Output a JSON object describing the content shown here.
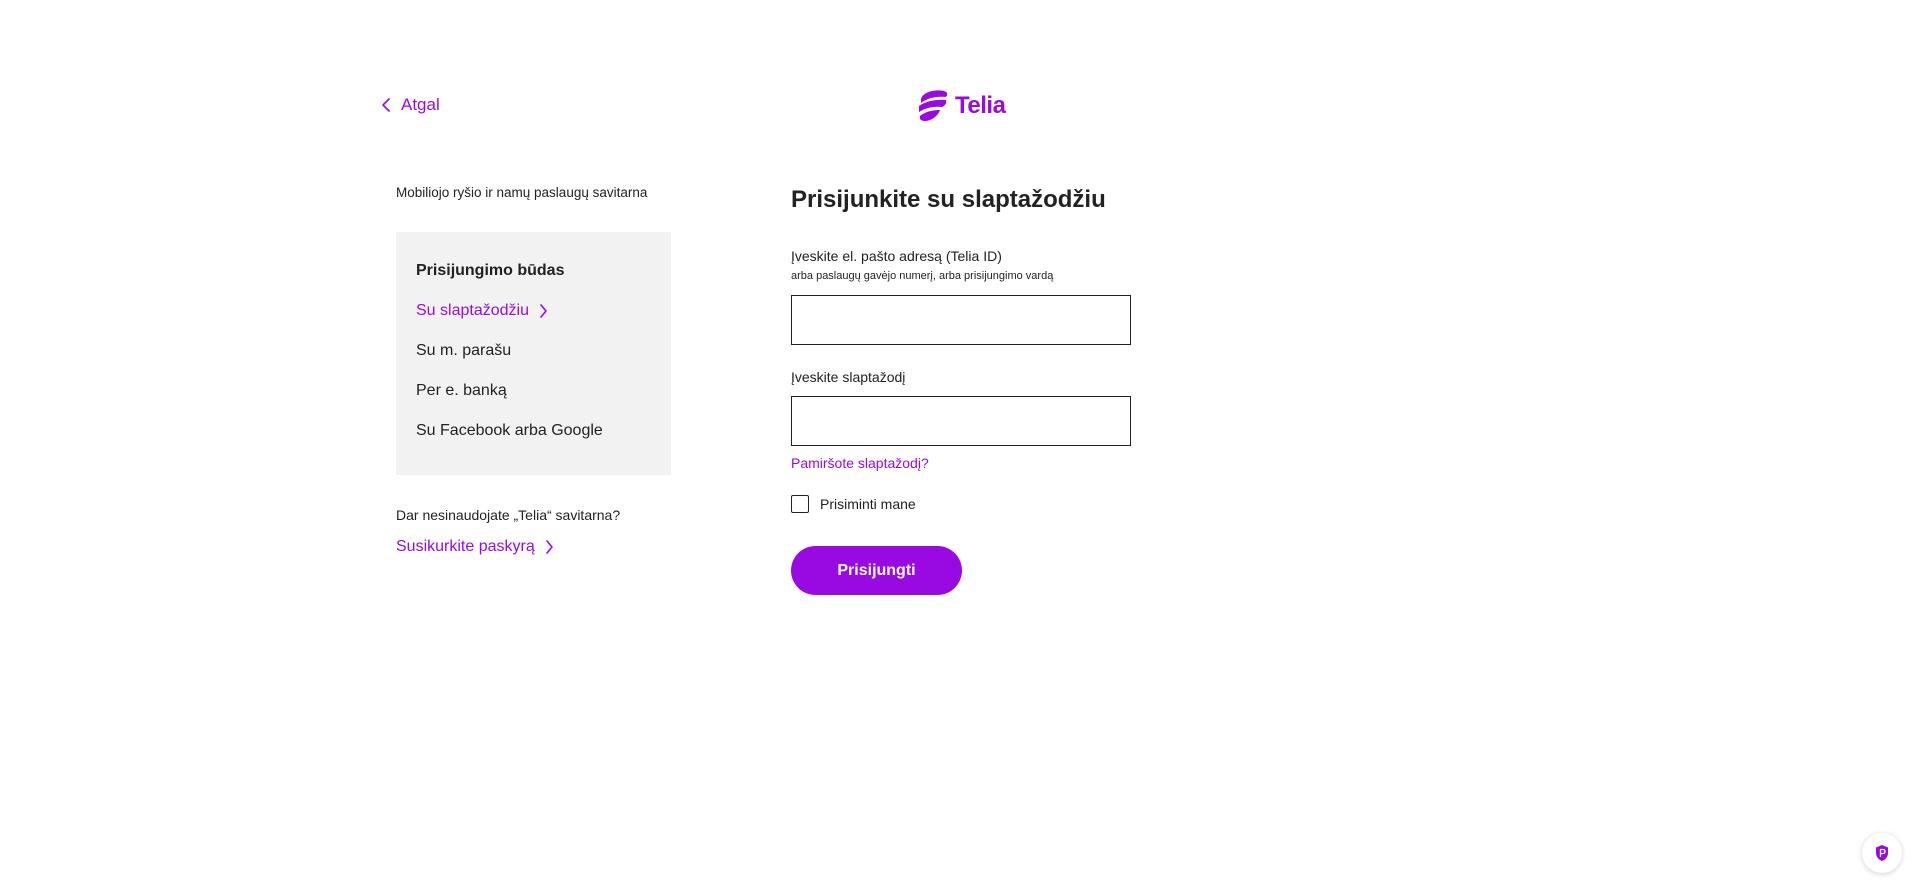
{
  "header": {
    "back_label": "Atgal",
    "logo_text": "Telia"
  },
  "sidebar": {
    "subtitle": "Mobiliojo ryšio ir namų paslaugų savitarna",
    "methods_title": "Prisijungimo būdas",
    "items": [
      {
        "label": "Su slaptažodžiu",
        "active": true
      },
      {
        "label": "Su m. parašu",
        "active": false
      },
      {
        "label": "Per e. banką",
        "active": false
      },
      {
        "label": "Su Facebook arba Google",
        "active": false
      }
    ],
    "no_account_text": "Dar nesinaudojate „Telia“ savitarna?",
    "create_account_label": "Susikurkite paskyrą"
  },
  "form": {
    "title": "Prisijunkite su slaptažodžiu",
    "email_label": "Įveskite el. pašto adresą (Telia ID)",
    "email_hint": "arba paslaugų gavėjo numerį, arba prisijungimo vardą",
    "email_value": "",
    "password_label": "Įveskite slaptažodį",
    "password_value": "",
    "forgot_label": "Pamiršote slaptažodį?",
    "remember_label": "Prisiminti mane",
    "remember_checked": false,
    "submit_label": "Prisijungti"
  },
  "colors": {
    "brand": "#990ae3",
    "text": "#222222",
    "panel_bg": "#f2f2f2"
  },
  "icons": {
    "back": "chevron-left-icon",
    "logo": "telia-pebble-icon",
    "item_arrow": "chevron-right-icon",
    "privacy": "shield-icon"
  }
}
